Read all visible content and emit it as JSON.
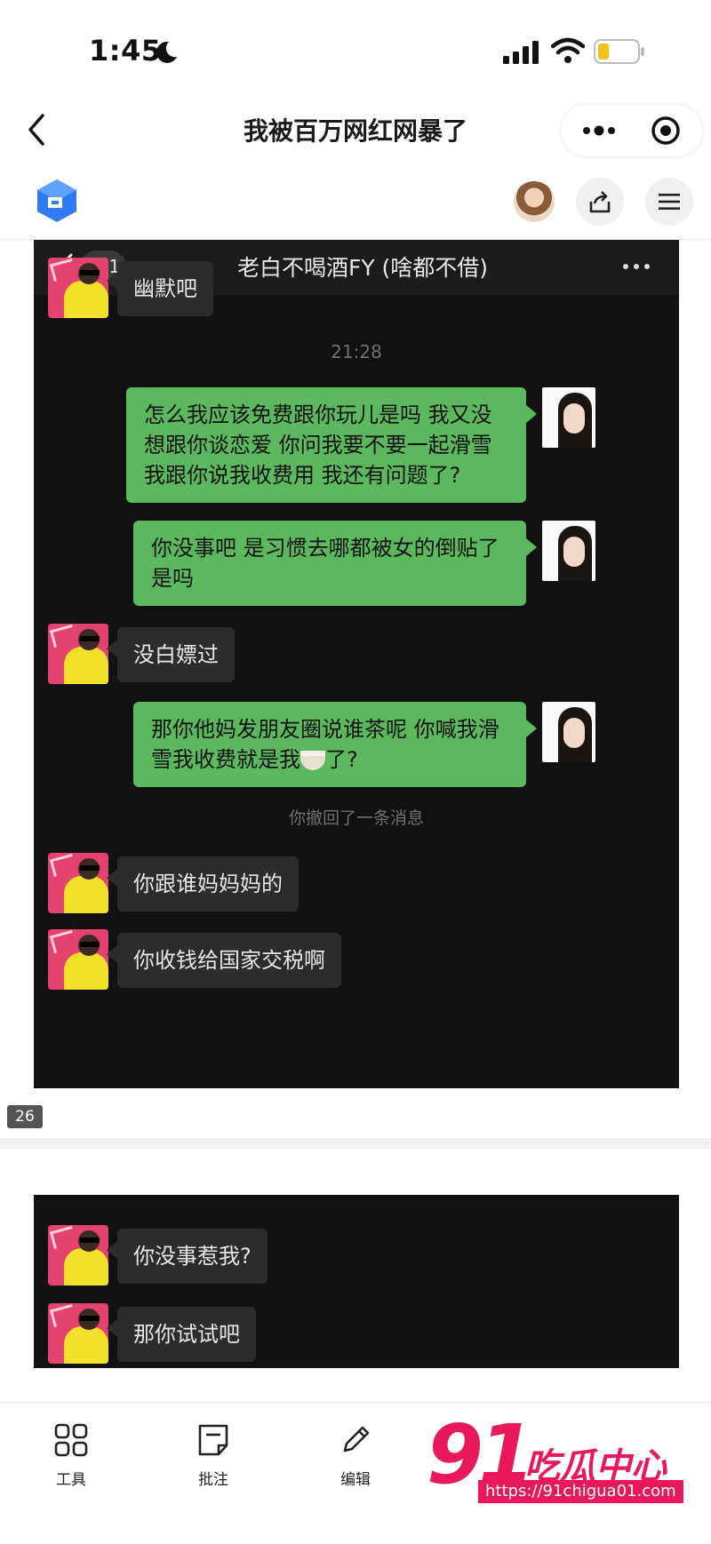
{
  "status_bar": {
    "time": "1:45"
  },
  "nav": {
    "title": "我被百万网红网暴了"
  },
  "chat": {
    "unread_count": "111",
    "title": "老白不喝酒FY (啥都不借)",
    "time_divider": "21:28",
    "messages": [
      {
        "side": "left",
        "text": "幽默吧"
      },
      {
        "side": "right",
        "lines": [
          "怎么我应该免费跟你玩儿是吗 我又没",
          "想跟你谈恋爱 你问我要不要一起滑雪",
          "我跟你说我收费用 我还有问题了?"
        ]
      },
      {
        "side": "right",
        "lines": [
          "你没事吧 是习惯去哪都被女的倒贴了",
          "是吗"
        ]
      },
      {
        "side": "left",
        "text": "没白嫖过"
      },
      {
        "side": "right",
        "lines": [
          "那你他妈发朋友圈说谁茶呢 你喊我滑",
          "雪我收费就是我",
          "了?"
        ]
      },
      {
        "side": "left",
        "text": "你跟谁妈妈妈的"
      },
      {
        "side": "left",
        "text": "你收钱给国家交税啊"
      }
    ],
    "system_note": "你撤回了一条消息"
  },
  "page_number": "26",
  "chat2": {
    "messages": [
      {
        "side": "left",
        "text": "你没事惹我?"
      },
      {
        "side": "left",
        "text": "那你试试吧"
      }
    ]
  },
  "toolbar": {
    "items": [
      {
        "label": "工具",
        "icon": "grid-icon"
      },
      {
        "label": "批注",
        "icon": "note-icon"
      },
      {
        "label": "编辑",
        "icon": "pencil-icon"
      }
    ]
  },
  "watermark": {
    "number": "91",
    "brand": "吃瓜中心",
    "url": "https://91chigua01.com"
  }
}
